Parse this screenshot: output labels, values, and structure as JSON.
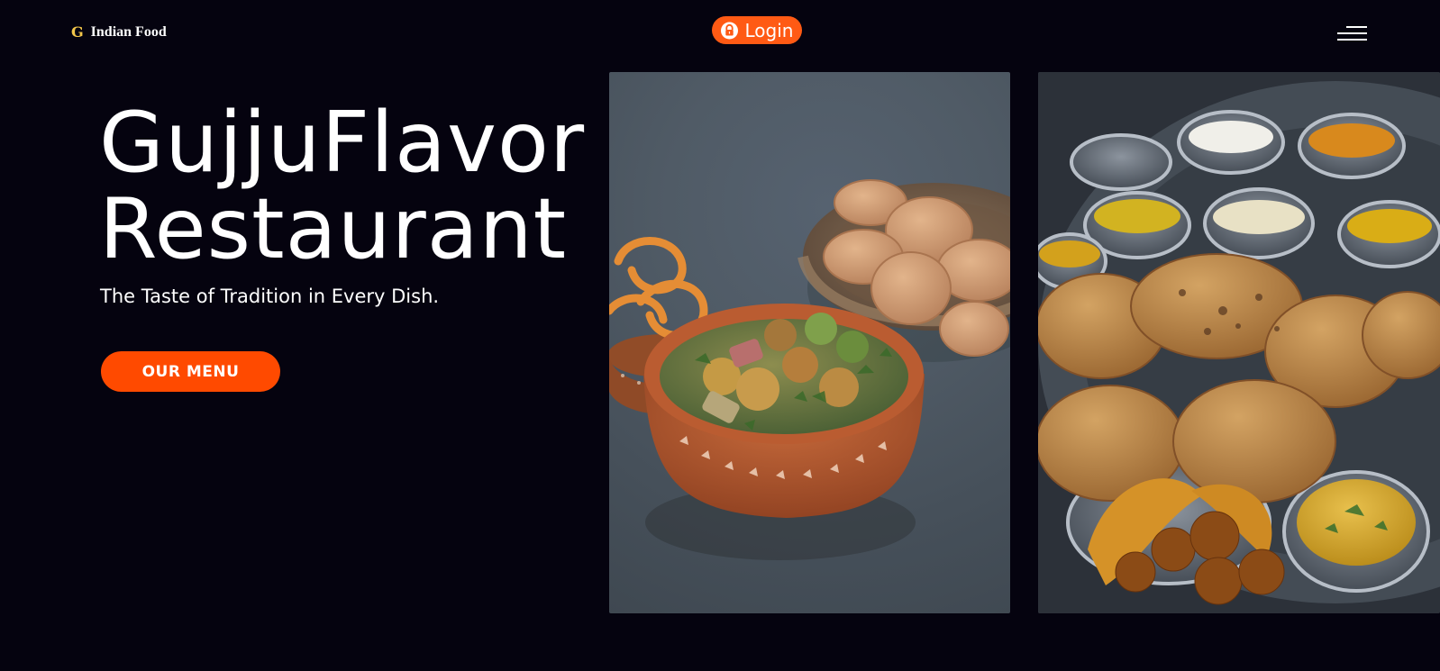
{
  "header": {
    "logo_mark": "G",
    "logo_text": "Indian Food",
    "login_label": "Login"
  },
  "hero": {
    "title_line1": "GujjuFlavor",
    "title_line2": "Restaurant",
    "tagline": "The Taste of Tradition in Every Dish.",
    "menu_button_label": "OUR MENU"
  },
  "colors": {
    "background": "#05030f",
    "accent": "#ff4a00",
    "login_accent": "#ff5a14",
    "logo_accent": "#f3c64a"
  },
  "icons": {
    "login": "lock-icon",
    "menu": "hamburger-menu-icon"
  }
}
